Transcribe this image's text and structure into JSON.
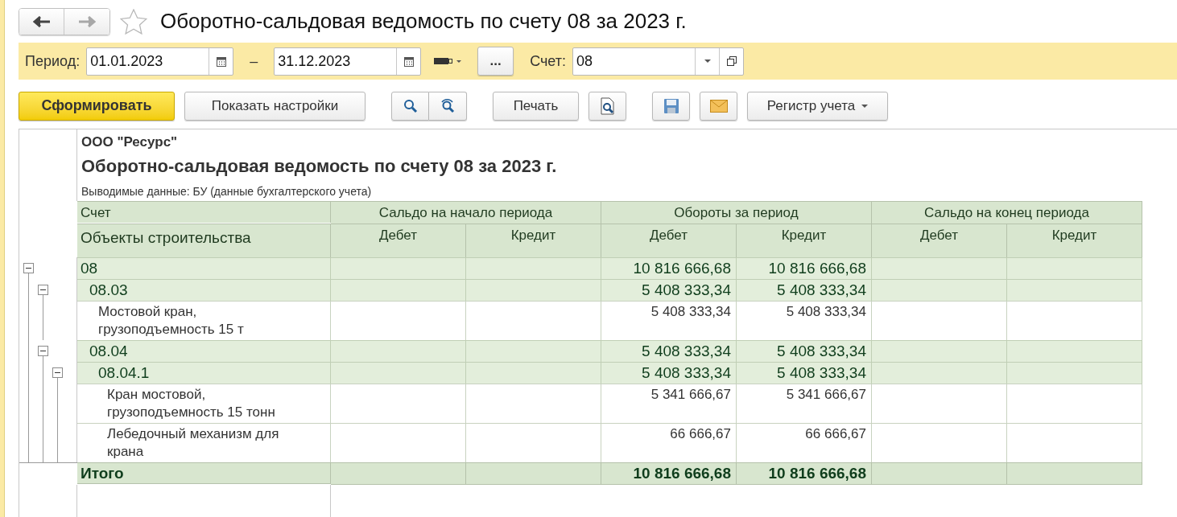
{
  "nav": [
    {
      "kind": "back",
      "disabled": false
    },
    {
      "kind": "forward",
      "disabled": true
    }
  ],
  "favorite": false,
  "title": "Оборотно-сальдовая ведомость по счету 08 за 2023 г.",
  "filter": {
    "period_label": "Период:",
    "date_from": "01.01.2023",
    "separator": "–",
    "date_to": "31.12.2023",
    "more_button": "...",
    "account_label": "Счет:",
    "account": "08"
  },
  "toolbar": {
    "generate_button": "Сформировать",
    "settings_button": "Показать настройки",
    "print_button": "Печать",
    "register_button": "Регистр учета"
  },
  "report": {
    "organization": "ООО \"Ресурс\"",
    "title": "Оборотно-сальдовая ведомость по счету 08 за 2023 г.",
    "subtitle": "Выводимые данные: БУ (данные бухгалтерского учета)",
    "header": {
      "account": "Счет",
      "objects": "Объекты строительства",
      "groups": [
        {
          "label": "Сальдо на начало периода",
          "debit": "Дебет",
          "credit": "Кредит"
        },
        {
          "label": "Обороты за период",
          "debit": "Дебет",
          "credit": "Кредит"
        },
        {
          "label": "Сальдо на конец периода",
          "debit": "Дебет",
          "credit": "Кредит"
        }
      ]
    },
    "rows": [
      {
        "name": "08",
        "expanded": true,
        "turnover_debit": "10 816 666,68",
        "turnover_credit": "10 816 666,68",
        "children": [
          {
            "name": "08.03",
            "expanded": true,
            "turnover_debit": "5 408 333,34",
            "turnover_credit": "5 408 333,34",
            "children": [
              {
                "name": "Мостовой кран, грузоподъемность 15 т",
                "turnover_debit": "5 408 333,34",
                "turnover_credit": "5 408 333,34"
              }
            ]
          },
          {
            "name": "08.04",
            "expanded": true,
            "turnover_debit": "5 408 333,34",
            "turnover_credit": "5 408 333,34",
            "children": [
              {
                "name": "08.04.1",
                "expanded": true,
                "turnover_debit": "5 408 333,34",
                "turnover_credit": "5 408 333,34",
                "children": [
                  {
                    "name": "Кран мостовой, грузоподъемность 15 тонн",
                    "turnover_debit": "5 341 666,67",
                    "turnover_credit": "5 341 666,67"
                  },
                  {
                    "name": "Лебедочный механизм для крана",
                    "turnover_debit": "66 666,67",
                    "turnover_credit": "66 666,67"
                  }
                ]
              }
            ]
          }
        ]
      }
    ],
    "total": {
      "label": "Итого",
      "turnover_debit": "10 816 666,68",
      "turnover_credit": "10 816 666,68"
    }
  }
}
